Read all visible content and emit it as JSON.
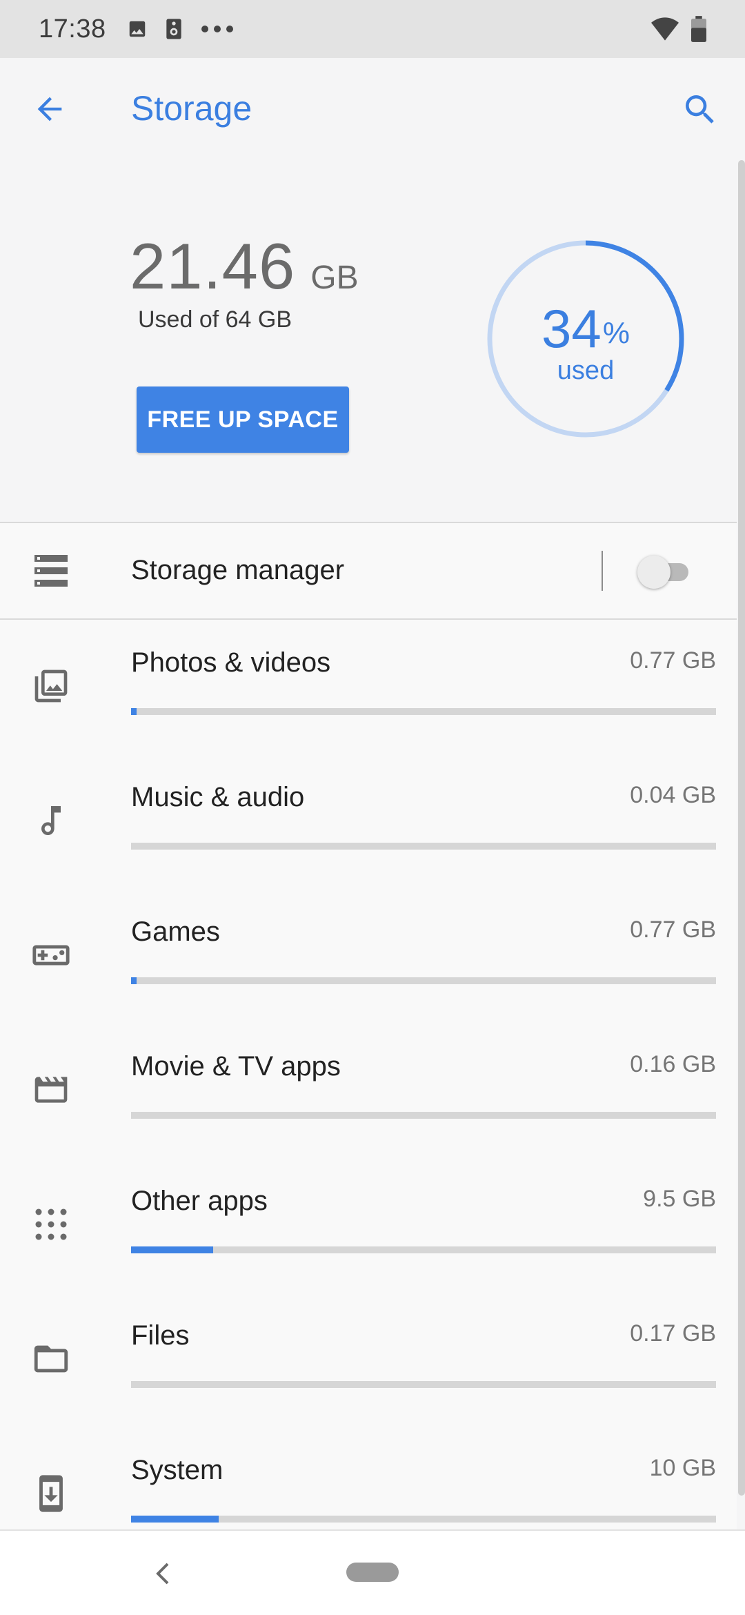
{
  "status_bar": {
    "time": "17:38"
  },
  "toolbar": {
    "title": "Storage"
  },
  "summary": {
    "used_value": "21.46",
    "used_unit": "GB",
    "used_of": "Used of 64 GB",
    "free_button": "FREE UP SPACE",
    "percent_value": "34",
    "percent_symbol": "%",
    "percent_caption": "used",
    "percent_fraction": 0.34
  },
  "storage_manager": {
    "label": "Storage manager",
    "enabled": false
  },
  "categories": [
    {
      "label": "Photos & videos",
      "size": "0.77 GB",
      "icon": "photo-library-icon",
      "fill": 0.01
    },
    {
      "label": "Music & audio",
      "size": "0.04 GB",
      "icon": "music-note-icon",
      "fill": 0.0
    },
    {
      "label": "Games",
      "size": "0.77 GB",
      "icon": "gamepad-icon",
      "fill": 0.01
    },
    {
      "label": "Movie & TV apps",
      "size": "0.16 GB",
      "icon": "movie-icon",
      "fill": 0.0
    },
    {
      "label": "Other apps",
      "size": "9.5 GB",
      "icon": "apps-grid-icon",
      "fill": 0.14
    },
    {
      "label": "Files",
      "size": "0.17 GB",
      "icon": "folder-icon",
      "fill": 0.0
    },
    {
      "label": "System",
      "size": "10 GB",
      "icon": "system-update-icon",
      "fill": 0.15
    }
  ],
  "colors": {
    "accent": "#3f83e4",
    "track": "#d6d6d6",
    "ring_track": "#c2d6f3"
  }
}
